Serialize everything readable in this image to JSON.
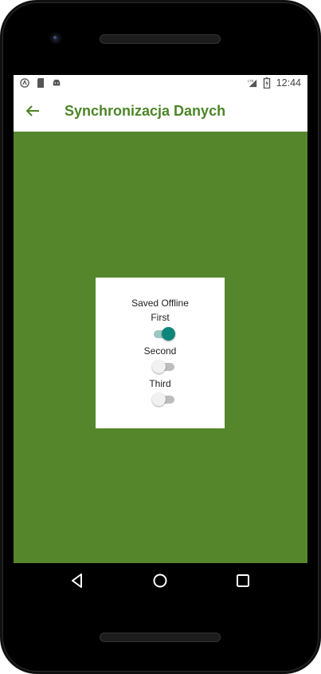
{
  "statusbar": {
    "time": "12:44",
    "icons_left": [
      "app-a-icon",
      "sd-card-icon",
      "android-icon"
    ],
    "icons_right": [
      "lte-signal-icon",
      "battery-charging-icon"
    ]
  },
  "appbar": {
    "title": "Synchronizacja Danych",
    "back_icon": "arrow-left-icon"
  },
  "card": {
    "heading": "Saved Offline",
    "toggles": [
      {
        "label": "First",
        "checked": true
      },
      {
        "label": "Second",
        "checked": false
      },
      {
        "label": "Third",
        "checked": false
      }
    ]
  },
  "navbar": {
    "icons": [
      "back-triangle-icon",
      "home-circle-icon",
      "recents-square-icon"
    ]
  },
  "colors": {
    "content_background": "#56862b",
    "title_color": "#4c8527",
    "switch_on": "#0e857a"
  }
}
